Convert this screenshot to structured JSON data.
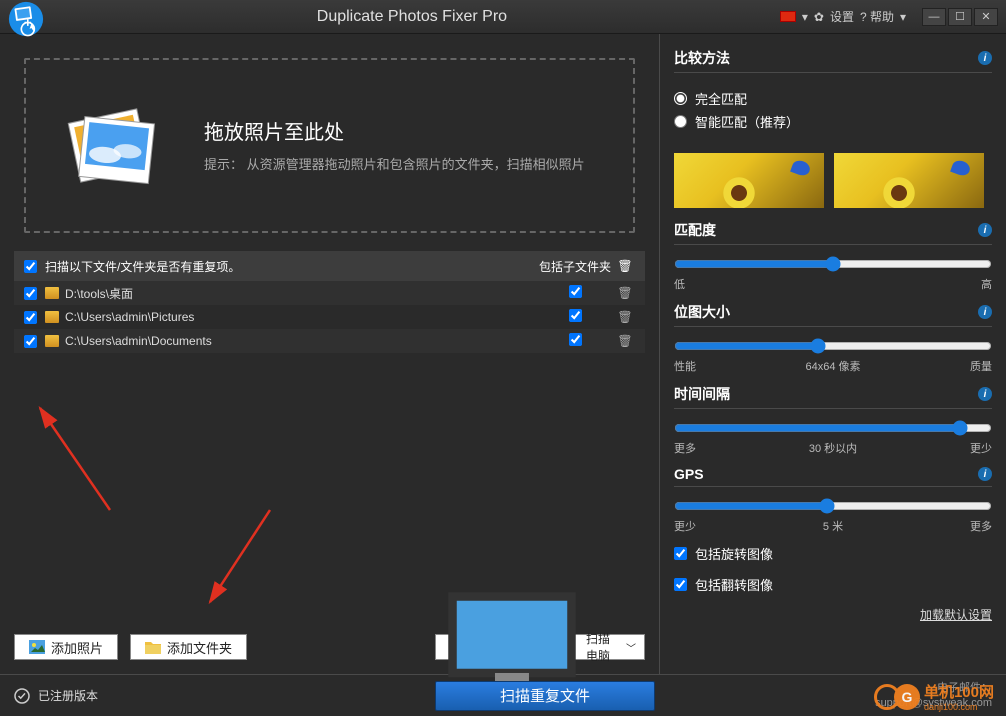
{
  "title": "Duplicate Photos Fixer Pro",
  "menu": {
    "settings": "设置",
    "help": "? 帮助"
  },
  "drop": {
    "heading": "拖放照片至此处",
    "hint": "提示：  从资源管理器拖动照片和包含照片的文件夹，扫描相似照片"
  },
  "list": {
    "headerText": "扫描以下文件/文件夹是否有重复项。",
    "subHeader": "包括子文件夹",
    "rows": [
      {
        "path": "D:\\tools\\桌面"
      },
      {
        "path": "C:\\Users\\admin\\Pictures"
      },
      {
        "path": "C:\\Users\\admin\\Documents"
      }
    ]
  },
  "buttons": {
    "addPhotos": "添加照片",
    "addFolder": "添加文件夹",
    "scanComputer": "扫描电脑"
  },
  "footer": {
    "registered": "已注册版本",
    "scan": "扫描重复文件"
  },
  "right": {
    "compare": "比较方法",
    "exact": "完全匹配",
    "smart": "智能匹配（推荐）",
    "match": "匹配度",
    "matchLow": "低",
    "matchHigh": "高",
    "bitmap": "位图大小",
    "bitmapLow": "性能",
    "bitmapMid": "64x64 像素",
    "bitmapHigh": "质量",
    "time": "时间间隔",
    "timeLow": "更多",
    "timeMid": "30 秒以内",
    "timeHigh": "更少",
    "gps": "GPS",
    "gpsLow": "更少",
    "gpsMid": "5 米",
    "gpsHigh": "更多",
    "rotate": "包括旋转图像",
    "flip": "包括翻转图像",
    "loadDefault": "加载默认设置"
  },
  "mail": {
    "l1": "电子邮件：",
    "l2": "support@systweak.com"
  },
  "watermark": {
    "text": "单机100网",
    "sub": "danji100.com"
  }
}
